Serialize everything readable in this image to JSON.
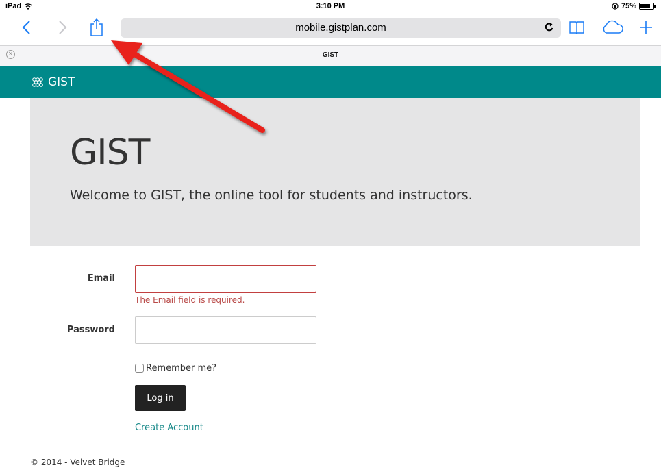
{
  "status_bar": {
    "device": "iPad",
    "time": "3:10 PM",
    "battery": "75%",
    "battery_level": 0.75
  },
  "browser": {
    "url": "mobile.gistplan.com",
    "tab_title": "GIST",
    "icons": [
      "back-icon",
      "forward-icon",
      "share-icon",
      "reload-icon",
      "bookmarks-icon",
      "icloud-tabs-icon",
      "new-tab-icon",
      "close-tab-icon"
    ],
    "accent_color": "#1a7cf5"
  },
  "site": {
    "brand": "GIST",
    "nav_color": "#00898a",
    "hero": {
      "title": "GIST",
      "subtitle": "Welcome to GIST, the online tool for students and instructors."
    },
    "form": {
      "email_label": "Email",
      "email_value": "",
      "email_error": "The Email field is required.",
      "password_label": "Password",
      "password_value": "",
      "remember_label": "Remember me?",
      "remember_checked": false,
      "login_label": "Log in",
      "create_account": "Create Account"
    },
    "footer": "© 2014 - Velvet Bridge"
  },
  "annotation": {
    "type": "arrow",
    "color": "#e8231b",
    "target": "share-button"
  }
}
